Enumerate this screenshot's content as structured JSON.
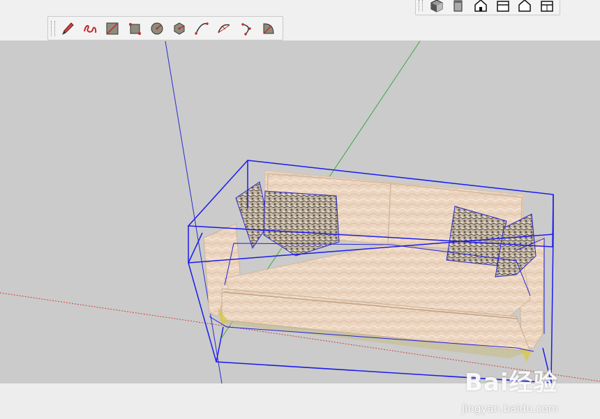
{
  "drawing_toolbar": {
    "tools": [
      {
        "name": "pencil-icon"
      },
      {
        "name": "freehand-icon"
      },
      {
        "name": "rectangle-icon"
      },
      {
        "name": "rotated-rectangle-icon"
      },
      {
        "name": "circle-icon"
      },
      {
        "name": "polygon-icon"
      },
      {
        "name": "arc-icon"
      },
      {
        "name": "two-point-arc-icon"
      },
      {
        "name": "three-point-arc-icon"
      },
      {
        "name": "pie-icon"
      }
    ]
  },
  "views_toolbar": {
    "views": [
      {
        "name": "iso-view-icon"
      },
      {
        "name": "top-view-icon"
      },
      {
        "name": "front-view-icon"
      },
      {
        "name": "right-view-icon"
      },
      {
        "name": "back-view-icon"
      },
      {
        "name": "left-view-icon"
      }
    ]
  },
  "watermark": {
    "brand": "Bai经验",
    "url": "jingyan.baidu.com"
  },
  "colors": {
    "viewport_bg": "#cbcbcb",
    "selection": "#1a1aee",
    "axis_red": "#d43c3c",
    "axis_green": "#3aaa3a",
    "axis_blue": "#2a2ad0",
    "sofa_fabric": "#ecd5c0",
    "pillow": "#b8aa98"
  }
}
